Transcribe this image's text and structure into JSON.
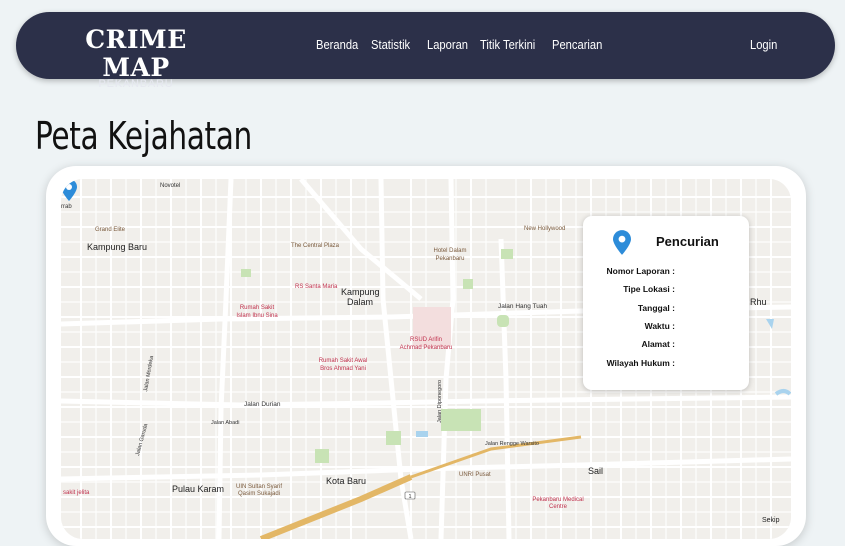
{
  "brand": {
    "title": "CRIME MAP",
    "subtitle": "PEKANBARU"
  },
  "nav": {
    "links": [
      "Beranda",
      "Statistik",
      "Laporan",
      "Titik Terkini",
      "Pencarian"
    ],
    "login": "Login"
  },
  "page": {
    "title": "Peta Kejahatan"
  },
  "map": {
    "place_labels": [
      "Novotel",
      "Grand Elite",
      "Kampung Baru",
      "The Central Plaza",
      "Hotel Dalam Pekanbaru",
      "New Hollywood",
      "RS Santa Maria",
      "Rumah Sakit Islam Ibnu Sina",
      "Kampung Dalam",
      "Jalan Hang Tuah",
      "RSUD Arifin Achmad Pekanbaru",
      "Rumah Sakit Awal Bros Ahmad Yani",
      "Jalan Durian",
      "Jalan Abadi",
      "Jalan Merdeka",
      "Jalan Garuda",
      "Jalan Diponegoro",
      "Jalan Rengge Warsito",
      "Pulau Karam",
      "UIN Sultan Syarif Qasim Sukajadi",
      "Kota Baru",
      "UNRI Pusat",
      "Sail",
      "Pekanbaru Medical Centre",
      "sakit jelita",
      "Rhu",
      "Sekip",
      "rrab"
    ],
    "road_shield": "1"
  },
  "info": {
    "title": "Pencurian",
    "fields": [
      {
        "label": "Nomor Laporan :",
        "value": ""
      },
      {
        "label": "Tipe Lokasi :",
        "value": ""
      },
      {
        "label": "Tanggal :",
        "value": ""
      },
      {
        "label": "Waktu :",
        "value": ""
      },
      {
        "label": "Alamat :",
        "value": ""
      },
      {
        "label": "Wilayah Hukum :",
        "value": ""
      }
    ]
  },
  "colors": {
    "navbar": "#2c3049",
    "background": "#eef3f5",
    "marker": "#2d8cd9",
    "map_land": "#f1efeb",
    "map_road": "#ffffff",
    "map_major_road": "#f2c56b",
    "map_park": "#c8e3b5"
  },
  "icons": {
    "marker": "map-pin-icon"
  }
}
